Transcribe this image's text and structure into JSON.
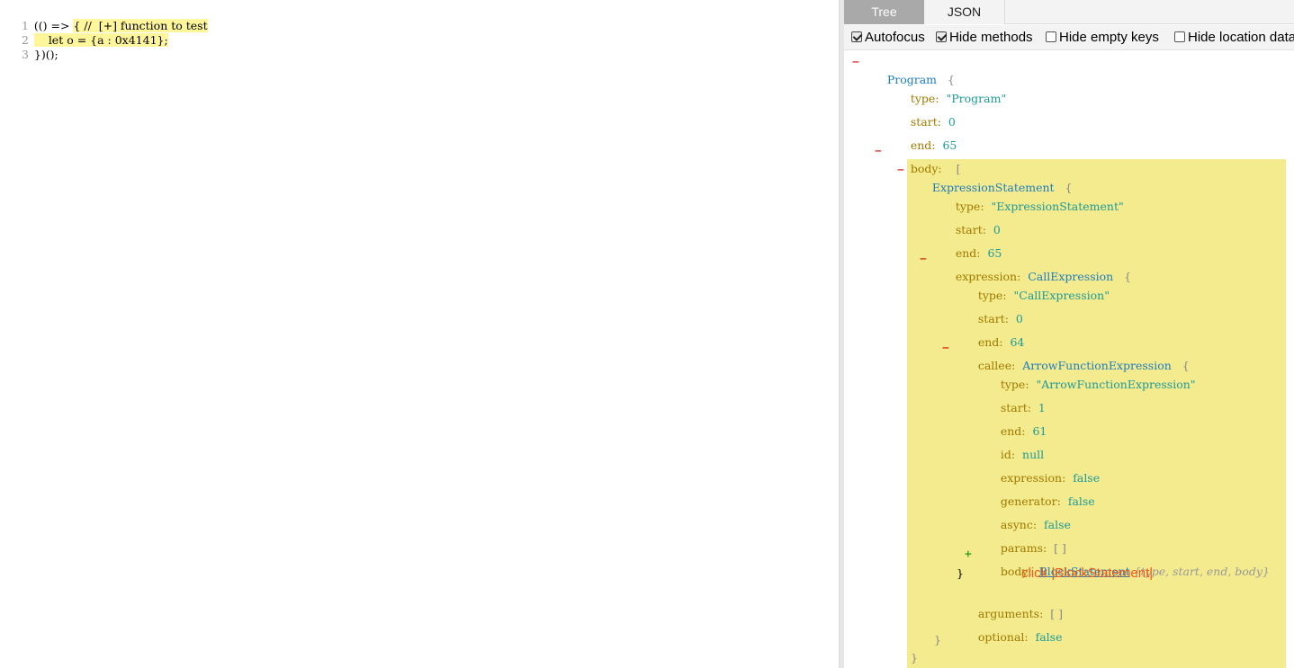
{
  "editor": {
    "lines": [
      {
        "num": "1",
        "pre": "(() => ",
        "hl": "{ //  [+] function to test"
      },
      {
        "num": "2",
        "pre": "    ",
        "hl": "let o = {a : 0x4141};"
      },
      {
        "num": "3",
        "pre": "",
        "hl": "})();"
      }
    ]
  },
  "tabs": {
    "tree": "Tree",
    "json": "JSON"
  },
  "options": [
    {
      "label": "Autofocus",
      "checked": true
    },
    {
      "label": "Hide methods",
      "checked": true
    },
    {
      "label": "Hide empty keys",
      "checked": false
    },
    {
      "label": "Hide location data",
      "checked": false
    }
  ],
  "tree": {
    "program": {
      "name": "Program",
      "brace": "{",
      "type_key": "type:",
      "type_val": "\"Program\"",
      "start_key": "start:",
      "start_val": "0",
      "end_key": "end:",
      "end_val": "65",
      "body_key": "body:",
      "body_bracket": "["
    },
    "expr_stmt": {
      "name": "ExpressionStatement",
      "brace": "{",
      "type_key": "type:",
      "type_val": "\"ExpressionStatement\"",
      "start_key": "start:",
      "start_val": "0",
      "end_key": "end:",
      "end_val": "65",
      "expression_key": "expression:",
      "expression_val": "CallExpression",
      "expression_brace": "{"
    },
    "call": {
      "type_key": "type:",
      "type_val": "\"CallExpression\"",
      "start_key": "start:",
      "start_val": "0",
      "end_key": "end:",
      "end_val": "64",
      "callee_key": "callee:",
      "callee_val": "ArrowFunctionExpression",
      "callee_brace": "{",
      "arguments_key": "arguments:",
      "arguments_val": "[ ]",
      "optional_key": "optional:",
      "optional_val": "false"
    },
    "arrow": {
      "type_key": "type:",
      "type_val": "\"ArrowFunctionExpression\"",
      "start_key": "start:",
      "start_val": "1",
      "end_key": "end:",
      "end_val": "61",
      "id_key": "id:",
      "id_val": "null",
      "expression_key": "expression:",
      "expression_val": "false",
      "generator_key": "generator:",
      "generator_val": "false",
      "async_key": "async:",
      "async_val": "false",
      "params_key": "params:",
      "params_val": "[ ]",
      "body_key": "body:",
      "body_val": "BlockStatement",
      "body_summary": "{type, start, end, body}"
    },
    "close_brace": "}",
    "minus": "−",
    "plus": "+"
  },
  "annotation": "click |BlockStatement|"
}
